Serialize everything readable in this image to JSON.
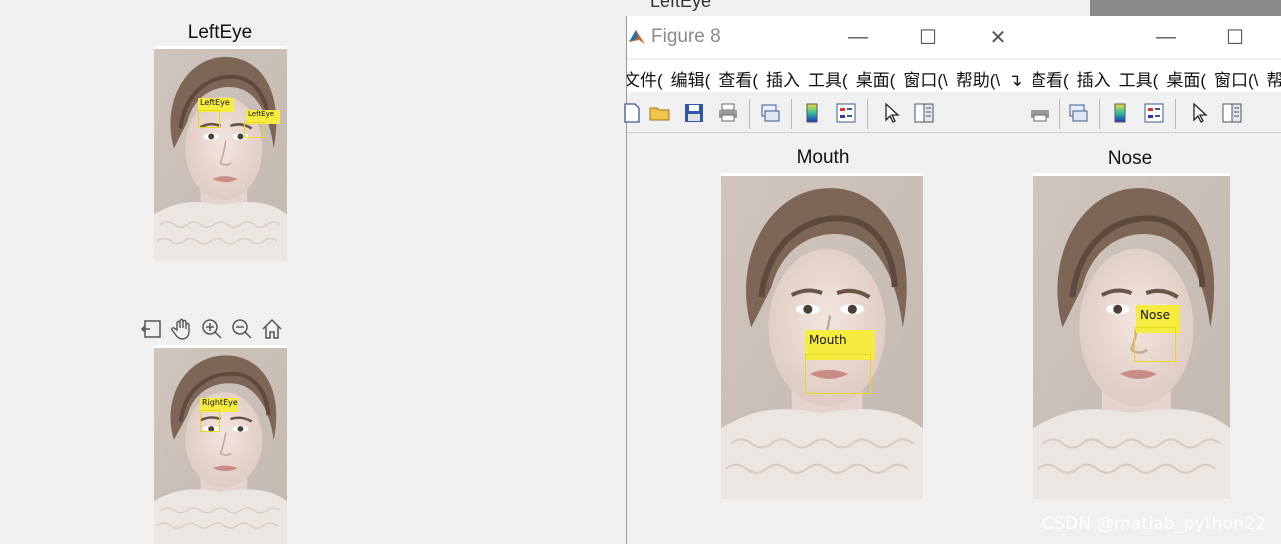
{
  "left_figure": {
    "title": "LeftEye",
    "top_labels": [
      "LeftEye",
      "LeftEye"
    ],
    "bottom_label": "RightEye",
    "axes_toolbar": [
      "restore-view-icon",
      "pan-hand-icon",
      "zoom-in-icon",
      "zoom-out-icon",
      "home-icon"
    ]
  },
  "back_window": {
    "title": "LeftEye"
  },
  "figure8": {
    "title": "Figure 8",
    "menu": [
      "文件(",
      "编辑(",
      "查看(",
      "插入",
      "工具(",
      "桌面(",
      "窗口(\\",
      "帮助(\\"
    ],
    "toolbar_icons": [
      "new-file-icon",
      "open-folder-icon",
      "save-icon",
      "print-icon",
      "link-plot-icon",
      "colorbar-icon",
      "legend-icon",
      "pointer-icon",
      "property-editor-icon"
    ],
    "plot_title": "Mouth",
    "label": "Mouth"
  },
  "right_window": {
    "menu": [
      "查看(",
      "插入",
      "工具(",
      "桌面(",
      "窗口(\\",
      "帮"
    ],
    "plot_title": "Nose",
    "label": "Nose"
  },
  "watermark": "CSDN @matlab_python22",
  "colors": {
    "label_bg": "#f5ec3f",
    "box_stroke": "#e9d820",
    "background": "#f0f0f0"
  }
}
